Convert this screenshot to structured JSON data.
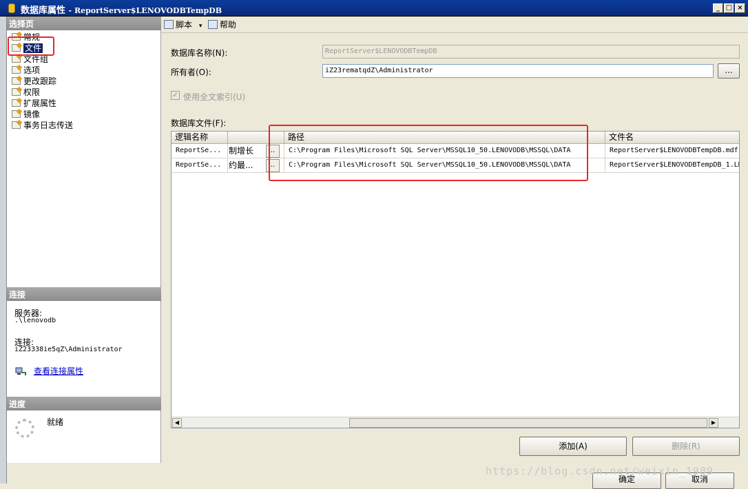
{
  "window": {
    "title": "数据库属性",
    "subtitle": "ReportServer$LENOVODBTempDB",
    "btn_min": "_",
    "btn_max": "□",
    "btn_close": "×"
  },
  "left": {
    "select_page_header": "选择页",
    "pages": [
      {
        "label": "常规"
      },
      {
        "label": "文件"
      },
      {
        "label": "文件组"
      },
      {
        "label": "选项"
      },
      {
        "label": "更改跟踪"
      },
      {
        "label": "权限"
      },
      {
        "label": "扩展属性"
      },
      {
        "label": "镜像"
      },
      {
        "label": "事务日志传送"
      }
    ],
    "connection_header": "连接",
    "server_label": "服务器:",
    "server_value": ".\\lenovodb",
    "conn_label": "连接:",
    "conn_value": "iZ23338ie5qZ\\Administrator",
    "view_link": "查看连接属性",
    "progress_header": "进度",
    "status": "就绪"
  },
  "toolbar": {
    "script_label": "脚本",
    "script_arrow": "▾",
    "help_label": "帮助"
  },
  "form": {
    "dbname_label": "数据库名称(N):",
    "dbname_value": "ReportServer$LENOVODBTempDB",
    "owner_label": "所有者(O):",
    "owner_value": "iZ23rematqdZ\\Administrator",
    "browse": "...",
    "fulltext_label": "使用全文索引(U)",
    "fulltext_check": "✓",
    "files_label": "数据库文件(F):"
  },
  "grid": {
    "columns": [
      "逻辑名称",
      "",
      "路径",
      "文件名"
    ],
    "rows": [
      {
        "logical": "ReportSe...",
        "growth": "制增长",
        "path": "C:\\Program Files\\Microsoft SQL Server\\MSSQL10_50.LENOVODB\\MSSQL\\DATA",
        "file": "ReportServer$LENOVODBTempDB.mdf"
      },
      {
        "logical": "ReportSe...",
        "growth": "约最...",
        "path": "C:\\Program Files\\Microsoft SQL Server\\MSSQL10_50.LENOVODB\\MSSQL\\DATA",
        "file": "ReportServer$LENOVODBTempDB_1.LD"
      }
    ],
    "dots": "..",
    "scroll_left": "◀",
    "scroll_right": "▶"
  },
  "buttons": {
    "add": "添加(A)",
    "remove": "删除(R)",
    "ok": "确定",
    "cancel": "取消"
  },
  "watermark": "https://blog.csdn.net/weixin_1989"
}
